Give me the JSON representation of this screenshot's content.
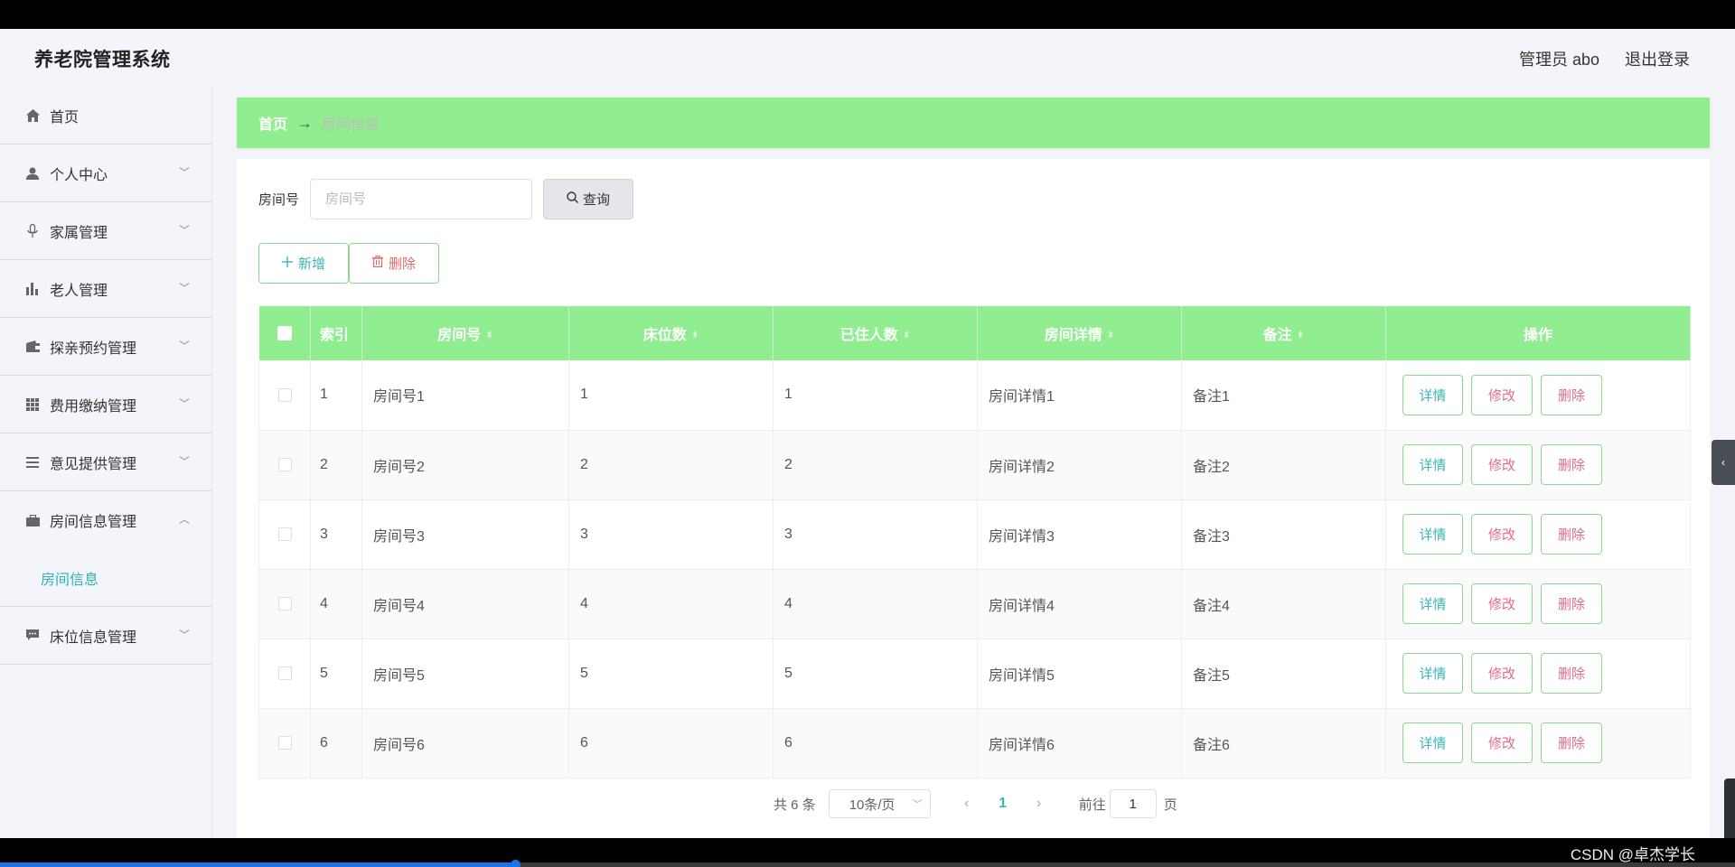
{
  "header": {
    "app_title": "养老院管理系统",
    "user_label": "管理员 abo",
    "logout_label": "退出登录"
  },
  "sidebar": {
    "items": [
      {
        "label": "首页",
        "icon": "home-icon"
      },
      {
        "label": "个人中心",
        "icon": "user-icon"
      },
      {
        "label": "家属管理",
        "icon": "microphone-icon"
      },
      {
        "label": "老人管理",
        "icon": "bar-chart-icon"
      },
      {
        "label": "探亲预约管理",
        "icon": "wallet-icon"
      },
      {
        "label": "费用缴纳管理",
        "icon": "grid-icon"
      },
      {
        "label": "意见提供管理",
        "icon": "list-icon"
      },
      {
        "label": "房间信息管理",
        "icon": "briefcase-icon"
      },
      {
        "label": "床位信息管理",
        "icon": "chat-icon"
      }
    ],
    "submenu_active": "房间信息"
  },
  "breadcrumb": {
    "home": "首页",
    "arrow": "→",
    "current": "房间信息"
  },
  "search": {
    "label": "房间号",
    "placeholder": "房间号",
    "query_label": "查询"
  },
  "actions": {
    "add_label": "新增",
    "delete_label": "删除"
  },
  "table": {
    "headers": [
      "索引",
      "房间号",
      "床位数",
      "已住人数",
      "房间详情",
      "备注",
      "操作"
    ],
    "rows": [
      {
        "idx": "1",
        "room": "房间号1",
        "beds": "1",
        "occupied": "1",
        "detail": "房间详情1",
        "note": "备注1"
      },
      {
        "idx": "2",
        "room": "房间号2",
        "beds": "2",
        "occupied": "2",
        "detail": "房间详情2",
        "note": "备注2"
      },
      {
        "idx": "3",
        "room": "房间号3",
        "beds": "3",
        "occupied": "3",
        "detail": "房间详情3",
        "note": "备注3"
      },
      {
        "idx": "4",
        "room": "房间号4",
        "beds": "4",
        "occupied": "4",
        "detail": "房间详情4",
        "note": "备注4"
      },
      {
        "idx": "5",
        "room": "房间号5",
        "beds": "5",
        "occupied": "5",
        "detail": "房间详情5",
        "note": "备注5"
      },
      {
        "idx": "6",
        "room": "房间号6",
        "beds": "6",
        "occupied": "6",
        "detail": "房间详情6",
        "note": "备注6"
      }
    ],
    "op_detail": "详情",
    "op_edit": "修改",
    "op_delete": "删除"
  },
  "pagination": {
    "total": "共 6 条",
    "page_size": "10条/页",
    "current_page": "1",
    "goto_label": "前往",
    "goto_value": "1",
    "page_suffix": "页"
  },
  "player": {
    "progress": 0.297
  },
  "watermark": "CSDN @卓杰学长",
  "colors": {
    "accent_green": "#90ee90",
    "teal_text": "#3bb5b5",
    "red_text": "#e06b8b"
  }
}
